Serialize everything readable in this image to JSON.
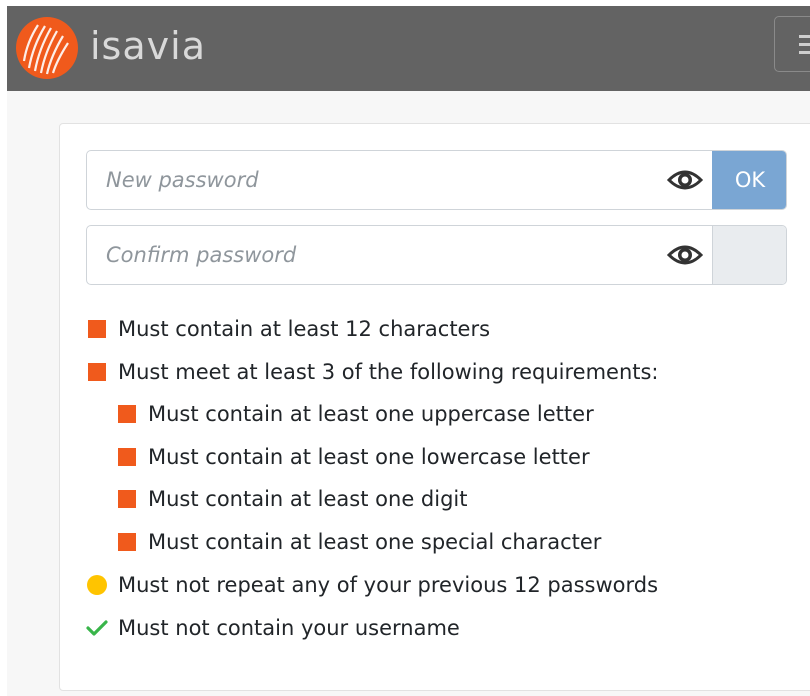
{
  "header": {
    "brand_name": "isavia",
    "logo_icon": "isavia-logo-icon",
    "menu_icon": "hamburger-menu-icon"
  },
  "form": {
    "new_password": {
      "placeholder": "New password",
      "value": "",
      "toggle_icon": "eye-icon"
    },
    "confirm_password": {
      "placeholder": "Confirm password",
      "value": "",
      "toggle_icon": "eye-icon"
    },
    "ok_label": "OK"
  },
  "requirements": [
    {
      "text": "Must contain at least 12 characters",
      "status": "unmet",
      "indent": 0
    },
    {
      "text": "Must meet at least 3 of the following requirements:",
      "status": "unmet",
      "indent": 0
    },
    {
      "text": "Must contain at least one uppercase letter",
      "status": "unmet",
      "indent": 1
    },
    {
      "text": "Must contain at least one lowercase letter",
      "status": "unmet",
      "indent": 1
    },
    {
      "text": "Must contain at least one digit",
      "status": "unmet",
      "indent": 1
    },
    {
      "text": "Must contain at least one special character",
      "status": "unmet",
      "indent": 1
    },
    {
      "text": "Must not repeat any of your previous 12 passwords",
      "status": "pending",
      "indent": 0
    },
    {
      "text": "Must not contain your username",
      "status": "met",
      "indent": 0
    }
  ],
  "colors": {
    "header_bg": "#636363",
    "brand_orange": "#f05a1c",
    "ok_button": "#7aa6d3",
    "pending_yellow": "#ffc400",
    "met_green": "#39b54a"
  }
}
